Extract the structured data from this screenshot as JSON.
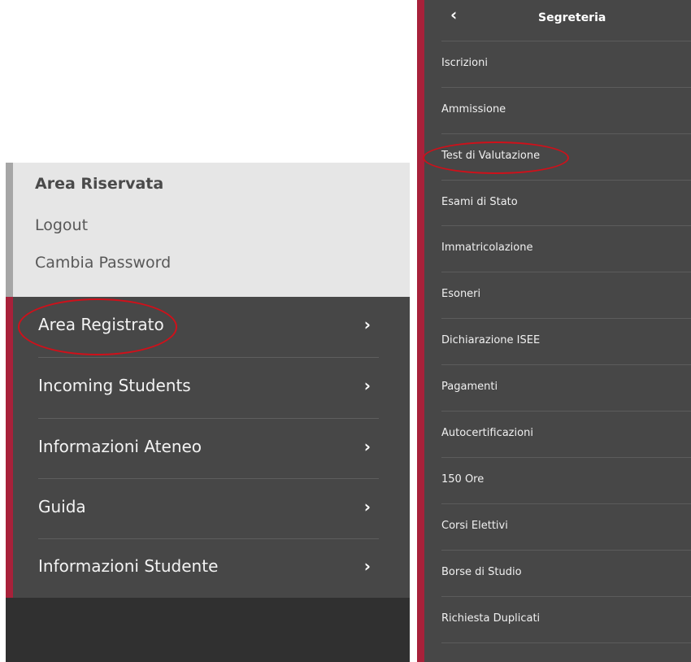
{
  "left_panel": {
    "reserved_area": {
      "title": "Area Riservata",
      "links": [
        "Logout",
        "Cambia Password"
      ]
    },
    "menu": [
      {
        "label": "Area Registrato",
        "chevron": "›"
      },
      {
        "label": "Incoming Students",
        "chevron": "›"
      },
      {
        "label": "Informazioni Ateneo",
        "chevron": "›"
      },
      {
        "label": "Guida",
        "chevron": "›"
      },
      {
        "label": "Informazioni Studente",
        "chevron": "›"
      }
    ]
  },
  "right_panel": {
    "back_icon": "‹",
    "title": "Segreteria",
    "items": [
      "Iscrizioni",
      "Ammissione",
      "Test di Valutazione",
      "Esami di Stato",
      "Immatricolazione",
      "Esoneri",
      "Dichiarazione ISEE",
      "Pagamenti",
      "Autocertificazioni",
      "150 Ore",
      "Corsi Elettivi",
      "Borse di Studio",
      "Richiesta Duplicati"
    ]
  },
  "colors": {
    "accent": "#a8213a",
    "menu_bg": "#474747",
    "reserved_bg": "#e6e6e6",
    "annotation": "#d0101a"
  }
}
